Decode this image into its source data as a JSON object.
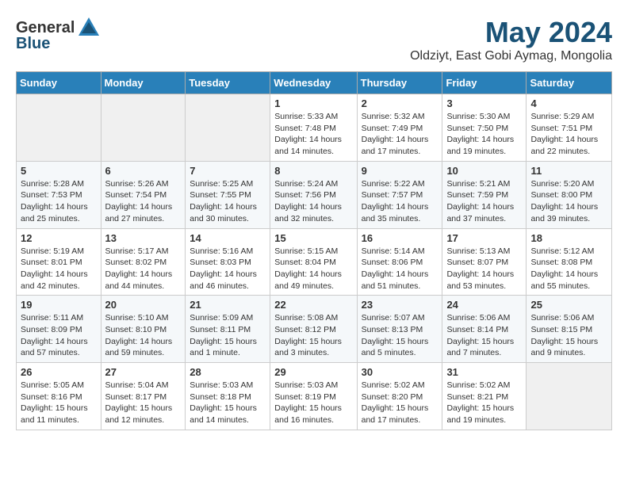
{
  "header": {
    "logo_general": "General",
    "logo_blue": "Blue",
    "month": "May 2024",
    "location": "Oldziyt, East Gobi Aymag, Mongolia"
  },
  "days_of_week": [
    "Sunday",
    "Monday",
    "Tuesday",
    "Wednesday",
    "Thursday",
    "Friday",
    "Saturday"
  ],
  "weeks": [
    [
      {
        "day": "",
        "info": ""
      },
      {
        "day": "",
        "info": ""
      },
      {
        "day": "",
        "info": ""
      },
      {
        "day": "1",
        "info": "Sunrise: 5:33 AM\nSunset: 7:48 PM\nDaylight: 14 hours\nand 14 minutes."
      },
      {
        "day": "2",
        "info": "Sunrise: 5:32 AM\nSunset: 7:49 PM\nDaylight: 14 hours\nand 17 minutes."
      },
      {
        "day": "3",
        "info": "Sunrise: 5:30 AM\nSunset: 7:50 PM\nDaylight: 14 hours\nand 19 minutes."
      },
      {
        "day": "4",
        "info": "Sunrise: 5:29 AM\nSunset: 7:51 PM\nDaylight: 14 hours\nand 22 minutes."
      }
    ],
    [
      {
        "day": "5",
        "info": "Sunrise: 5:28 AM\nSunset: 7:53 PM\nDaylight: 14 hours\nand 25 minutes."
      },
      {
        "day": "6",
        "info": "Sunrise: 5:26 AM\nSunset: 7:54 PM\nDaylight: 14 hours\nand 27 minutes."
      },
      {
        "day": "7",
        "info": "Sunrise: 5:25 AM\nSunset: 7:55 PM\nDaylight: 14 hours\nand 30 minutes."
      },
      {
        "day": "8",
        "info": "Sunrise: 5:24 AM\nSunset: 7:56 PM\nDaylight: 14 hours\nand 32 minutes."
      },
      {
        "day": "9",
        "info": "Sunrise: 5:22 AM\nSunset: 7:57 PM\nDaylight: 14 hours\nand 35 minutes."
      },
      {
        "day": "10",
        "info": "Sunrise: 5:21 AM\nSunset: 7:59 PM\nDaylight: 14 hours\nand 37 minutes."
      },
      {
        "day": "11",
        "info": "Sunrise: 5:20 AM\nSunset: 8:00 PM\nDaylight: 14 hours\nand 39 minutes."
      }
    ],
    [
      {
        "day": "12",
        "info": "Sunrise: 5:19 AM\nSunset: 8:01 PM\nDaylight: 14 hours\nand 42 minutes."
      },
      {
        "day": "13",
        "info": "Sunrise: 5:17 AM\nSunset: 8:02 PM\nDaylight: 14 hours\nand 44 minutes."
      },
      {
        "day": "14",
        "info": "Sunrise: 5:16 AM\nSunset: 8:03 PM\nDaylight: 14 hours\nand 46 minutes."
      },
      {
        "day": "15",
        "info": "Sunrise: 5:15 AM\nSunset: 8:04 PM\nDaylight: 14 hours\nand 49 minutes."
      },
      {
        "day": "16",
        "info": "Sunrise: 5:14 AM\nSunset: 8:06 PM\nDaylight: 14 hours\nand 51 minutes."
      },
      {
        "day": "17",
        "info": "Sunrise: 5:13 AM\nSunset: 8:07 PM\nDaylight: 14 hours\nand 53 minutes."
      },
      {
        "day": "18",
        "info": "Sunrise: 5:12 AM\nSunset: 8:08 PM\nDaylight: 14 hours\nand 55 minutes."
      }
    ],
    [
      {
        "day": "19",
        "info": "Sunrise: 5:11 AM\nSunset: 8:09 PM\nDaylight: 14 hours\nand 57 minutes."
      },
      {
        "day": "20",
        "info": "Sunrise: 5:10 AM\nSunset: 8:10 PM\nDaylight: 14 hours\nand 59 minutes."
      },
      {
        "day": "21",
        "info": "Sunrise: 5:09 AM\nSunset: 8:11 PM\nDaylight: 15 hours\nand 1 minute."
      },
      {
        "day": "22",
        "info": "Sunrise: 5:08 AM\nSunset: 8:12 PM\nDaylight: 15 hours\nand 3 minutes."
      },
      {
        "day": "23",
        "info": "Sunrise: 5:07 AM\nSunset: 8:13 PM\nDaylight: 15 hours\nand 5 minutes."
      },
      {
        "day": "24",
        "info": "Sunrise: 5:06 AM\nSunset: 8:14 PM\nDaylight: 15 hours\nand 7 minutes."
      },
      {
        "day": "25",
        "info": "Sunrise: 5:06 AM\nSunset: 8:15 PM\nDaylight: 15 hours\nand 9 minutes."
      }
    ],
    [
      {
        "day": "26",
        "info": "Sunrise: 5:05 AM\nSunset: 8:16 PM\nDaylight: 15 hours\nand 11 minutes."
      },
      {
        "day": "27",
        "info": "Sunrise: 5:04 AM\nSunset: 8:17 PM\nDaylight: 15 hours\nand 12 minutes."
      },
      {
        "day": "28",
        "info": "Sunrise: 5:03 AM\nSunset: 8:18 PM\nDaylight: 15 hours\nand 14 minutes."
      },
      {
        "day": "29",
        "info": "Sunrise: 5:03 AM\nSunset: 8:19 PM\nDaylight: 15 hours\nand 16 minutes."
      },
      {
        "day": "30",
        "info": "Sunrise: 5:02 AM\nSunset: 8:20 PM\nDaylight: 15 hours\nand 17 minutes."
      },
      {
        "day": "31",
        "info": "Sunrise: 5:02 AM\nSunset: 8:21 PM\nDaylight: 15 hours\nand 19 minutes."
      },
      {
        "day": "",
        "info": ""
      }
    ]
  ]
}
